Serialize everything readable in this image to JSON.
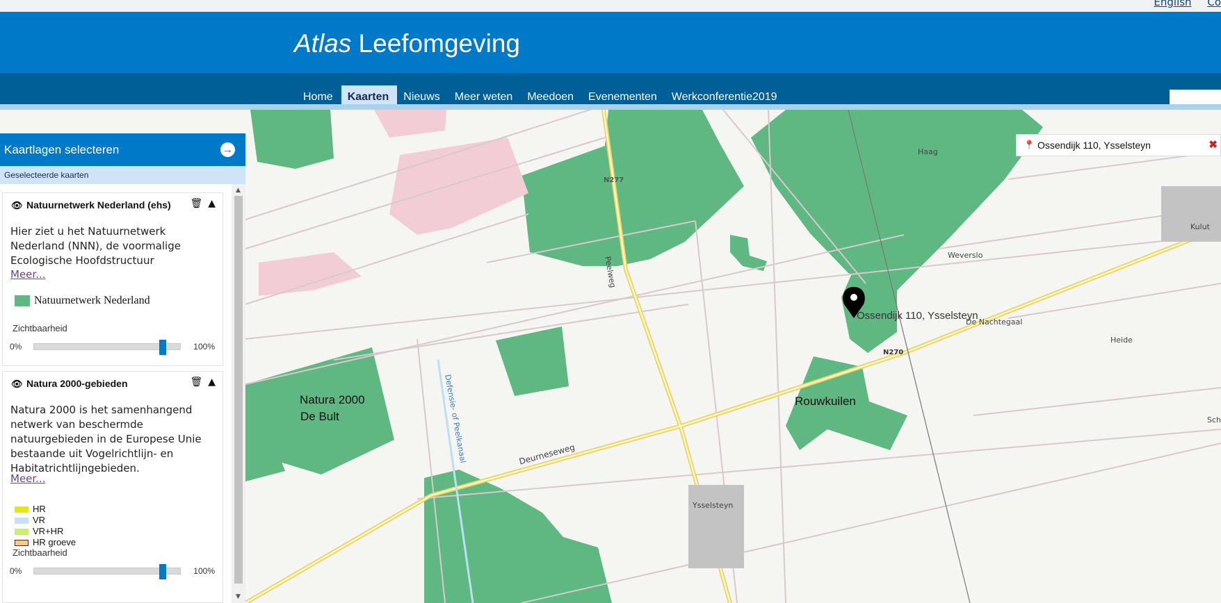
{
  "top_links": [
    "English",
    "Co"
  ],
  "brand": {
    "italic": "Atlas",
    "regular": "Leefomgeving"
  },
  "nav": {
    "items": [
      "Home",
      "Kaarten",
      "Nieuws",
      "Meer weten",
      "Meedoen",
      "Evenementen",
      "Werkconferentie2019"
    ],
    "active": "Kaarten"
  },
  "panel": {
    "title": "Kaartlagen selecteren",
    "subtitle": "Geselecteerde kaarten",
    "layers": [
      {
        "name": "Natuurnetwerk Nederland (ehs)",
        "description": "Hier ziet u het Natuurnetwerk Nederland (NNN), de voormalige Ecologische Hoofdstructuur",
        "more": "Meer...",
        "legend": [
          {
            "label": "Natuurnetwerk Nederland",
            "color": "#5fb882"
          }
        ],
        "visibility_label": "Zichtbaarheid",
        "min_label": "0%",
        "max_label": "100%",
        "visibility_value": 0.88
      },
      {
        "name": "Natura 2000-gebieden",
        "description": "Natura 2000 is het samenhangend netwerk van beschermde natuurgebieden in de Europese Unie bestaande uit Vogelrichtlijn- en Habitatrichtlijngebieden.",
        "more": "Meer...",
        "legend": [
          {
            "label": "HR",
            "color": "#e8e800"
          },
          {
            "label": "VR",
            "color": "#c4e3f7"
          },
          {
            "label": "VR+HR",
            "color": "#c8f06a"
          },
          {
            "label": "HR groeve",
            "color": "#f7c98a"
          }
        ],
        "visibility_label": "Zichtbaarheid",
        "min_label": "0%",
        "max_label": "100%",
        "visibility_value": 0.88
      }
    ]
  },
  "search": {
    "value": "Ossendijk 110, Ysselsteyn"
  },
  "map": {
    "marker_label": "Ossendijk 110, Ysselsteyn",
    "annotations": [
      "Natura 2000",
      "De Bult",
      "Rouwkuilen"
    ],
    "places": [
      "Haag",
      "Weverslo",
      "Kulut",
      "De Nachtegaal",
      "Heide",
      "Ysselsteyn",
      "Sch"
    ],
    "roads": [
      "N277",
      "N270",
      "Peelweg",
      "Deurneseweg",
      "Defensie- of Peelkanaal"
    ],
    "colors": {
      "nature": "#5fb882",
      "road": "#f2e48a",
      "accent": "#0079c9"
    }
  }
}
